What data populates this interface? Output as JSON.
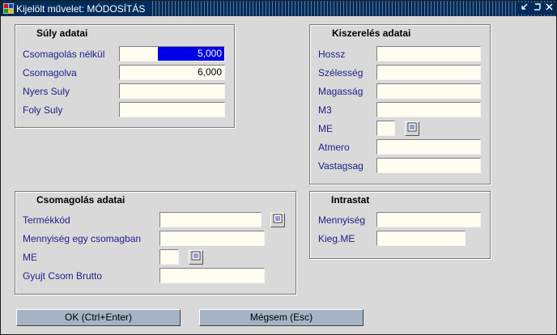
{
  "window": {
    "title": "Kijelölt művelet: MÓDOSÍTÁS",
    "controls": [
      "minimize-icon",
      "maximize-icon",
      "close-icon"
    ]
  },
  "suly": {
    "title": "Súly adatai",
    "rows": [
      {
        "label": "Csomagolás nélkül",
        "value": "5,000"
      },
      {
        "label": "Csomagolva",
        "value": "6,000"
      },
      {
        "label": "Nyers Suly",
        "value": ""
      },
      {
        "label": "Foly Suly",
        "value": ""
      }
    ]
  },
  "kiszereles": {
    "title": "Kiszerelés adatai",
    "rows": [
      {
        "label": "Hossz",
        "value": ""
      },
      {
        "label": "Szélesség",
        "value": ""
      },
      {
        "label": "Magasság",
        "value": ""
      },
      {
        "label": "M3",
        "value": ""
      },
      {
        "label": "ME",
        "value": ""
      },
      {
        "label": "Atmero",
        "value": ""
      },
      {
        "label": "Vastagsag",
        "value": ""
      }
    ]
  },
  "csomagolas": {
    "title": "Csomagolás adatai",
    "rows": [
      {
        "label": "Termékkód",
        "value": ""
      },
      {
        "label": "Mennyiség egy csomagban",
        "value": ""
      },
      {
        "label": "ME",
        "value": ""
      },
      {
        "label": "Gyujt Csom Brutto",
        "value": ""
      }
    ]
  },
  "intrastat": {
    "title": "Intrastat",
    "rows": [
      {
        "label": "Mennyiség",
        "value": ""
      },
      {
        "label": "Kieg.ME",
        "value": ""
      }
    ]
  },
  "buttons": {
    "ok": "OK (Ctrl+Enter)",
    "cancel": "Mégsem (Esc)"
  }
}
